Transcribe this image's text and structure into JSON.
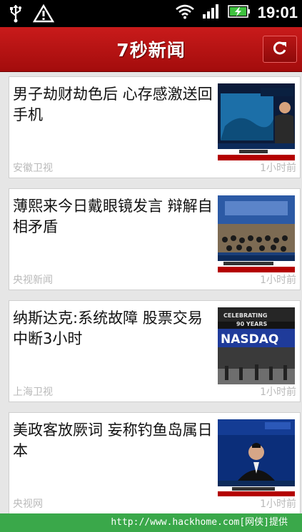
{
  "status_bar": {
    "icons": [
      "usb-icon",
      "alert-icon",
      "wifi-icon",
      "signal-icon",
      "battery-charging-icon"
    ],
    "time": "19:01"
  },
  "app_bar": {
    "title": "7秒新闻",
    "refresh_icon": "refresh-icon",
    "accent_color": "#b81414"
  },
  "news": [
    {
      "title": "男子劫财劫色后 心存感激送回手机",
      "source": "安徽卫视",
      "time": "1小时前",
      "thumb": "tv-news-anchor-thumbnail"
    },
    {
      "title": "薄熙来今日戴眼镜发言 辩解自相矛盾",
      "source": "央视新闻",
      "time": "1小时前",
      "thumb": "courtroom-thumbnail"
    },
    {
      "title": "纳斯达克:系统故障 股票交易中断3小时",
      "source": "上海卫视",
      "time": "1小时前",
      "thumb": "nasdaq-thumbnail"
    },
    {
      "title": "美政客放厥词 妄称钓鱼岛属日本",
      "source": "央视网",
      "time": "1小时前",
      "thumb": "news-anchor-thumbnail"
    }
  ],
  "watermark": "http://www.hackhome.com[网侠]提供"
}
